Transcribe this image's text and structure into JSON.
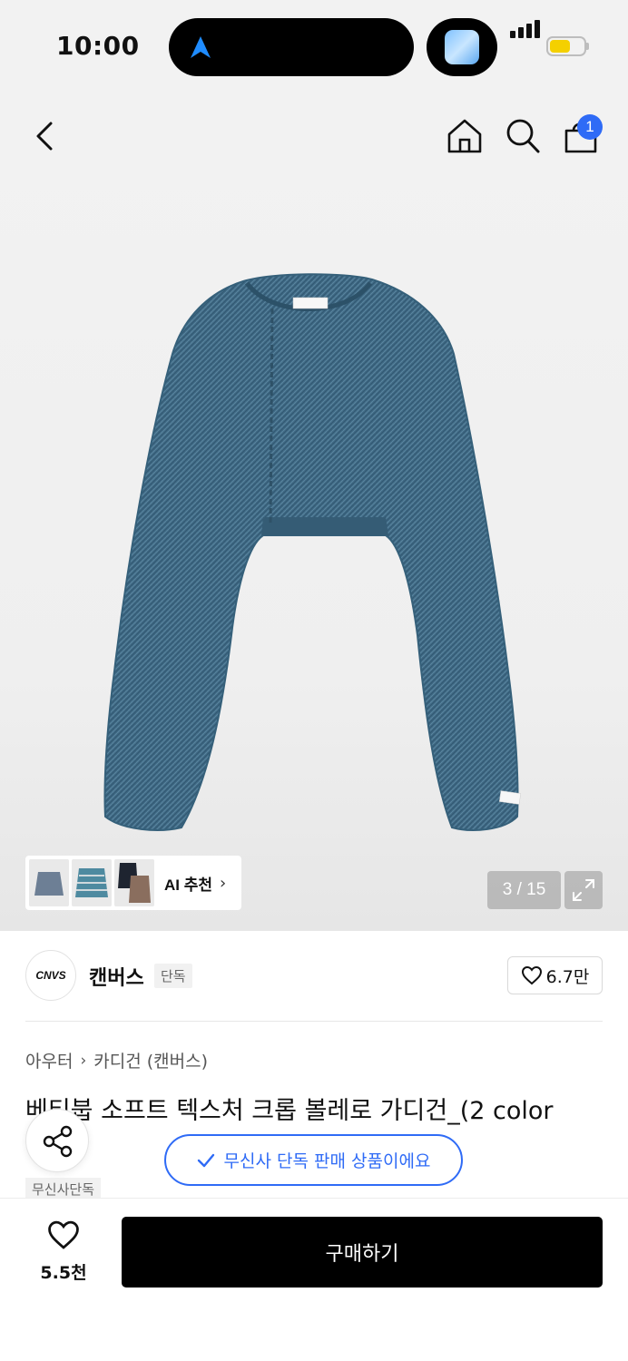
{
  "status_bar": {
    "time": "10:00"
  },
  "header": {
    "icons": [
      "back-icon",
      "home-icon",
      "search-icon",
      "cart-icon"
    ],
    "cart_count": "1"
  },
  "gallery": {
    "ai_recommend_label": "AI 추천",
    "page_counter": "3 / 15",
    "product_color": "#3f6883"
  },
  "brand": {
    "logo_text": "CNVS",
    "name": "캔버스",
    "exclusive_tag": "단독",
    "like_count": "6.7만"
  },
  "breadcrumb": {
    "category": "아우터",
    "subcategory": "카디건 (캔버스)"
  },
  "product": {
    "title": "베티붑 소프트 텍스처 크롭 볼레로 가디건_(2 color",
    "tag": "무신사단독"
  },
  "toast": {
    "message": "무신사 단독 판매 상품이에요"
  },
  "bottom_bar": {
    "wish_count": "5.5천",
    "buy_label": "구매하기"
  },
  "colors": {
    "accent": "#2f6bf6",
    "buy_button": "#000000"
  }
}
